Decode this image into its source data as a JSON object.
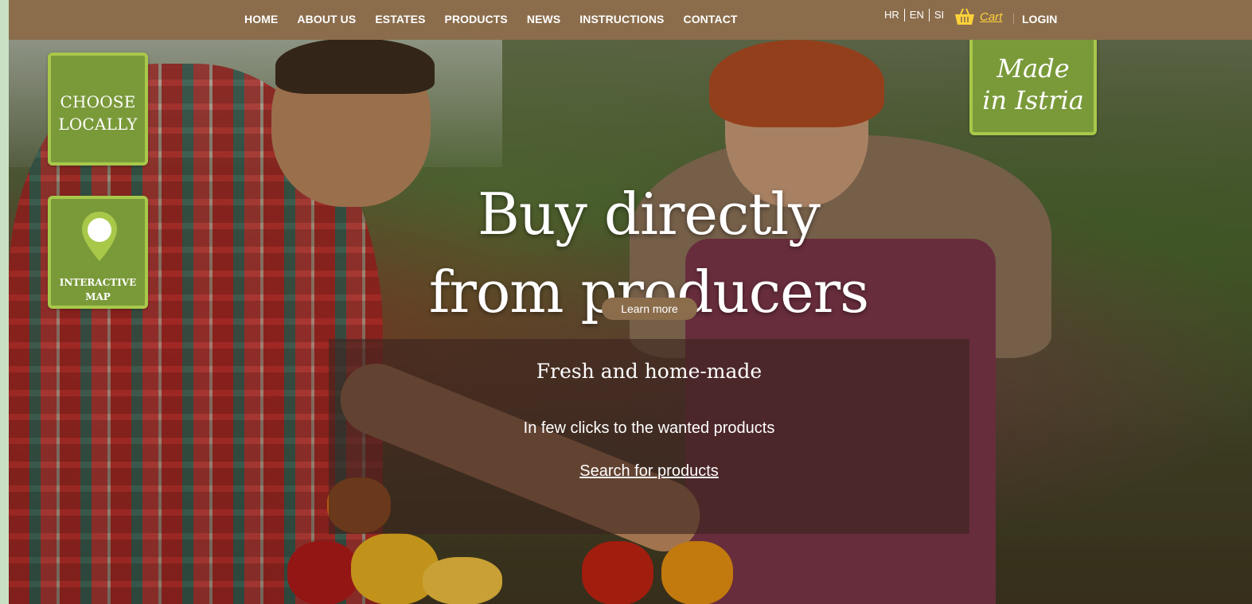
{
  "nav": {
    "items": [
      "HOME",
      "ABOUT US",
      "ESTATES",
      "PRODUCTS",
      "NEWS",
      "INSTRUCTIONS",
      "CONTACT"
    ],
    "languages": [
      "HR",
      "EN",
      "SI"
    ],
    "cart_label": "Cart",
    "cart_icon": "basket-icon",
    "login_label": "LOGIN"
  },
  "badges": {
    "choose_locally": "CHOOSE LOCALLY",
    "interactive_map": "INTERACTIVE MAP",
    "map_icon": "map-pin-icon",
    "made_in": "Made in Istria"
  },
  "hero": {
    "headline_line1": "Buy directly",
    "headline_line2": "from producers",
    "learn_more": "Learn more"
  },
  "search_panel": {
    "title": "Fresh and home-made",
    "subtitle": "In few clicks to the wanted products",
    "link": "Search for products"
  },
  "colors": {
    "nav_bg": "#8b6d4c",
    "badge_green": "#7a9a3a",
    "badge_border": "#a8c84a",
    "cart_yellow": "#ffd23a"
  }
}
